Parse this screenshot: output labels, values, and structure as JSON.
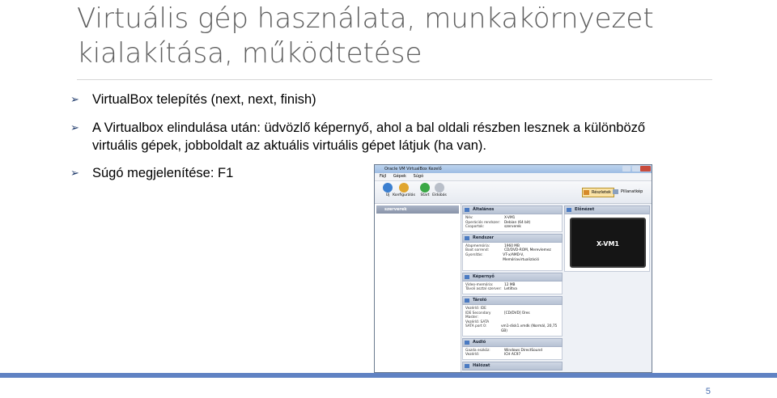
{
  "slide": {
    "title_line1": "Virtuális gép használata, munkakörnyezet",
    "title_line2": "kialakítása, működtetése",
    "bullets": [
      {
        "text": "VirtualBox telepítés (next, next, finish)"
      },
      {
        "line1": "A Virtualbox elindulása után: üdvözlő képernyő, ahol a bal oldali részben lesznek a különböző",
        "line2": "virtuális gépek, jobboldalt az aktuális virtuális gépet látjuk (ha van)."
      },
      {
        "text": "Súgó megjelenítése: F1"
      }
    ],
    "bullet_glyph": "➢",
    "page_number": "5",
    "accent": "#6082c3"
  },
  "vbox": {
    "window_title": "Oracle VM VirtualBox Kezelő",
    "menu": [
      "Fájl",
      "Gépek",
      "Súgó"
    ],
    "toolbar": {
      "new": "Új",
      "settings": "Konfigurálás",
      "start": "Start",
      "discard": "Eldobás",
      "details": "Részletek",
      "snapshots": "Pillanatkép"
    },
    "group": "szerverek",
    "sections": {
      "general": {
        "title": "Általános",
        "rows": [
          [
            "Név:",
            "X-VM1"
          ],
          [
            "Operációs rendszer:",
            "Debian (64 bit)"
          ],
          [
            "Csoportok:",
            "szerverek"
          ]
        ]
      },
      "system": {
        "title": "Rendszer",
        "rows": [
          [
            "Alapmemória:",
            "1960 MB"
          ],
          [
            "Boot sorrend:",
            "CD/DVD-ROM, Merevlemez"
          ],
          [
            "Gyorsítás:",
            "VT-x/AMD-V, Memóriavirtualizáció"
          ]
        ]
      },
      "display": {
        "title": "Képernyő",
        "rows": [
          [
            "Video-memória:",
            "12 MB"
          ],
          [
            "Távoli asztal szerver:",
            "Letiltva"
          ]
        ]
      },
      "storage": {
        "title": "Tároló",
        "rows": [
          [
            "Vezérlő: IDE",
            ""
          ],
          [
            "IDE Secondary Master:",
            "[CD/DVD] Üres"
          ],
          [
            "Vezérlő: SATA",
            ""
          ],
          [
            "SATA port 0:",
            "vm1-disk1.vmdk (Normál, 20,75 GB)"
          ]
        ]
      },
      "audio": {
        "title": "Audió",
        "rows": [
          [
            "Gazda eszköz:",
            "Windows DirectSound"
          ],
          [
            "Vezérlő:",
            "ICH AC97"
          ]
        ]
      },
      "network": {
        "title": "Hálózat"
      },
      "preview": {
        "title": "Előnézet",
        "vm_name": "X-VM1"
      }
    }
  }
}
